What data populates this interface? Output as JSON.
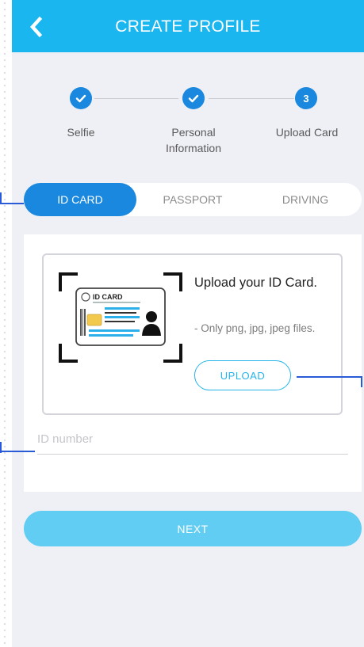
{
  "header": {
    "title": "CREATE PROFILE",
    "back_icon": "chevron-left-icon"
  },
  "steps": [
    {
      "label_line1": "Selfie",
      "label_line2": "",
      "state": "done",
      "indicator": ""
    },
    {
      "label_line1": "Personal",
      "label_line2": "Information",
      "state": "done",
      "indicator": ""
    },
    {
      "label_line1": "Upload Card",
      "label_line2": "",
      "state": "current",
      "indicator": "3"
    }
  ],
  "tabs": [
    {
      "label": "ID CARD",
      "active": true
    },
    {
      "label": "PASSPORT",
      "active": false
    },
    {
      "label": "DRIVING",
      "active": false
    }
  ],
  "upload": {
    "card_label": "ID CARD",
    "title": "Upload your ID Card.",
    "hint": "- Only png, jpg, jpeg files.",
    "button_label": "UPLOAD"
  },
  "id_number": {
    "placeholder": "ID number",
    "value": ""
  },
  "next_label": "NEXT",
  "colors": {
    "header": "#1ab6ef",
    "accent": "#1a88de",
    "upload_border": "#25b4ea",
    "next": "#62cdf2",
    "background": "#eef0f6",
    "pointer": "#2a5bd7"
  }
}
